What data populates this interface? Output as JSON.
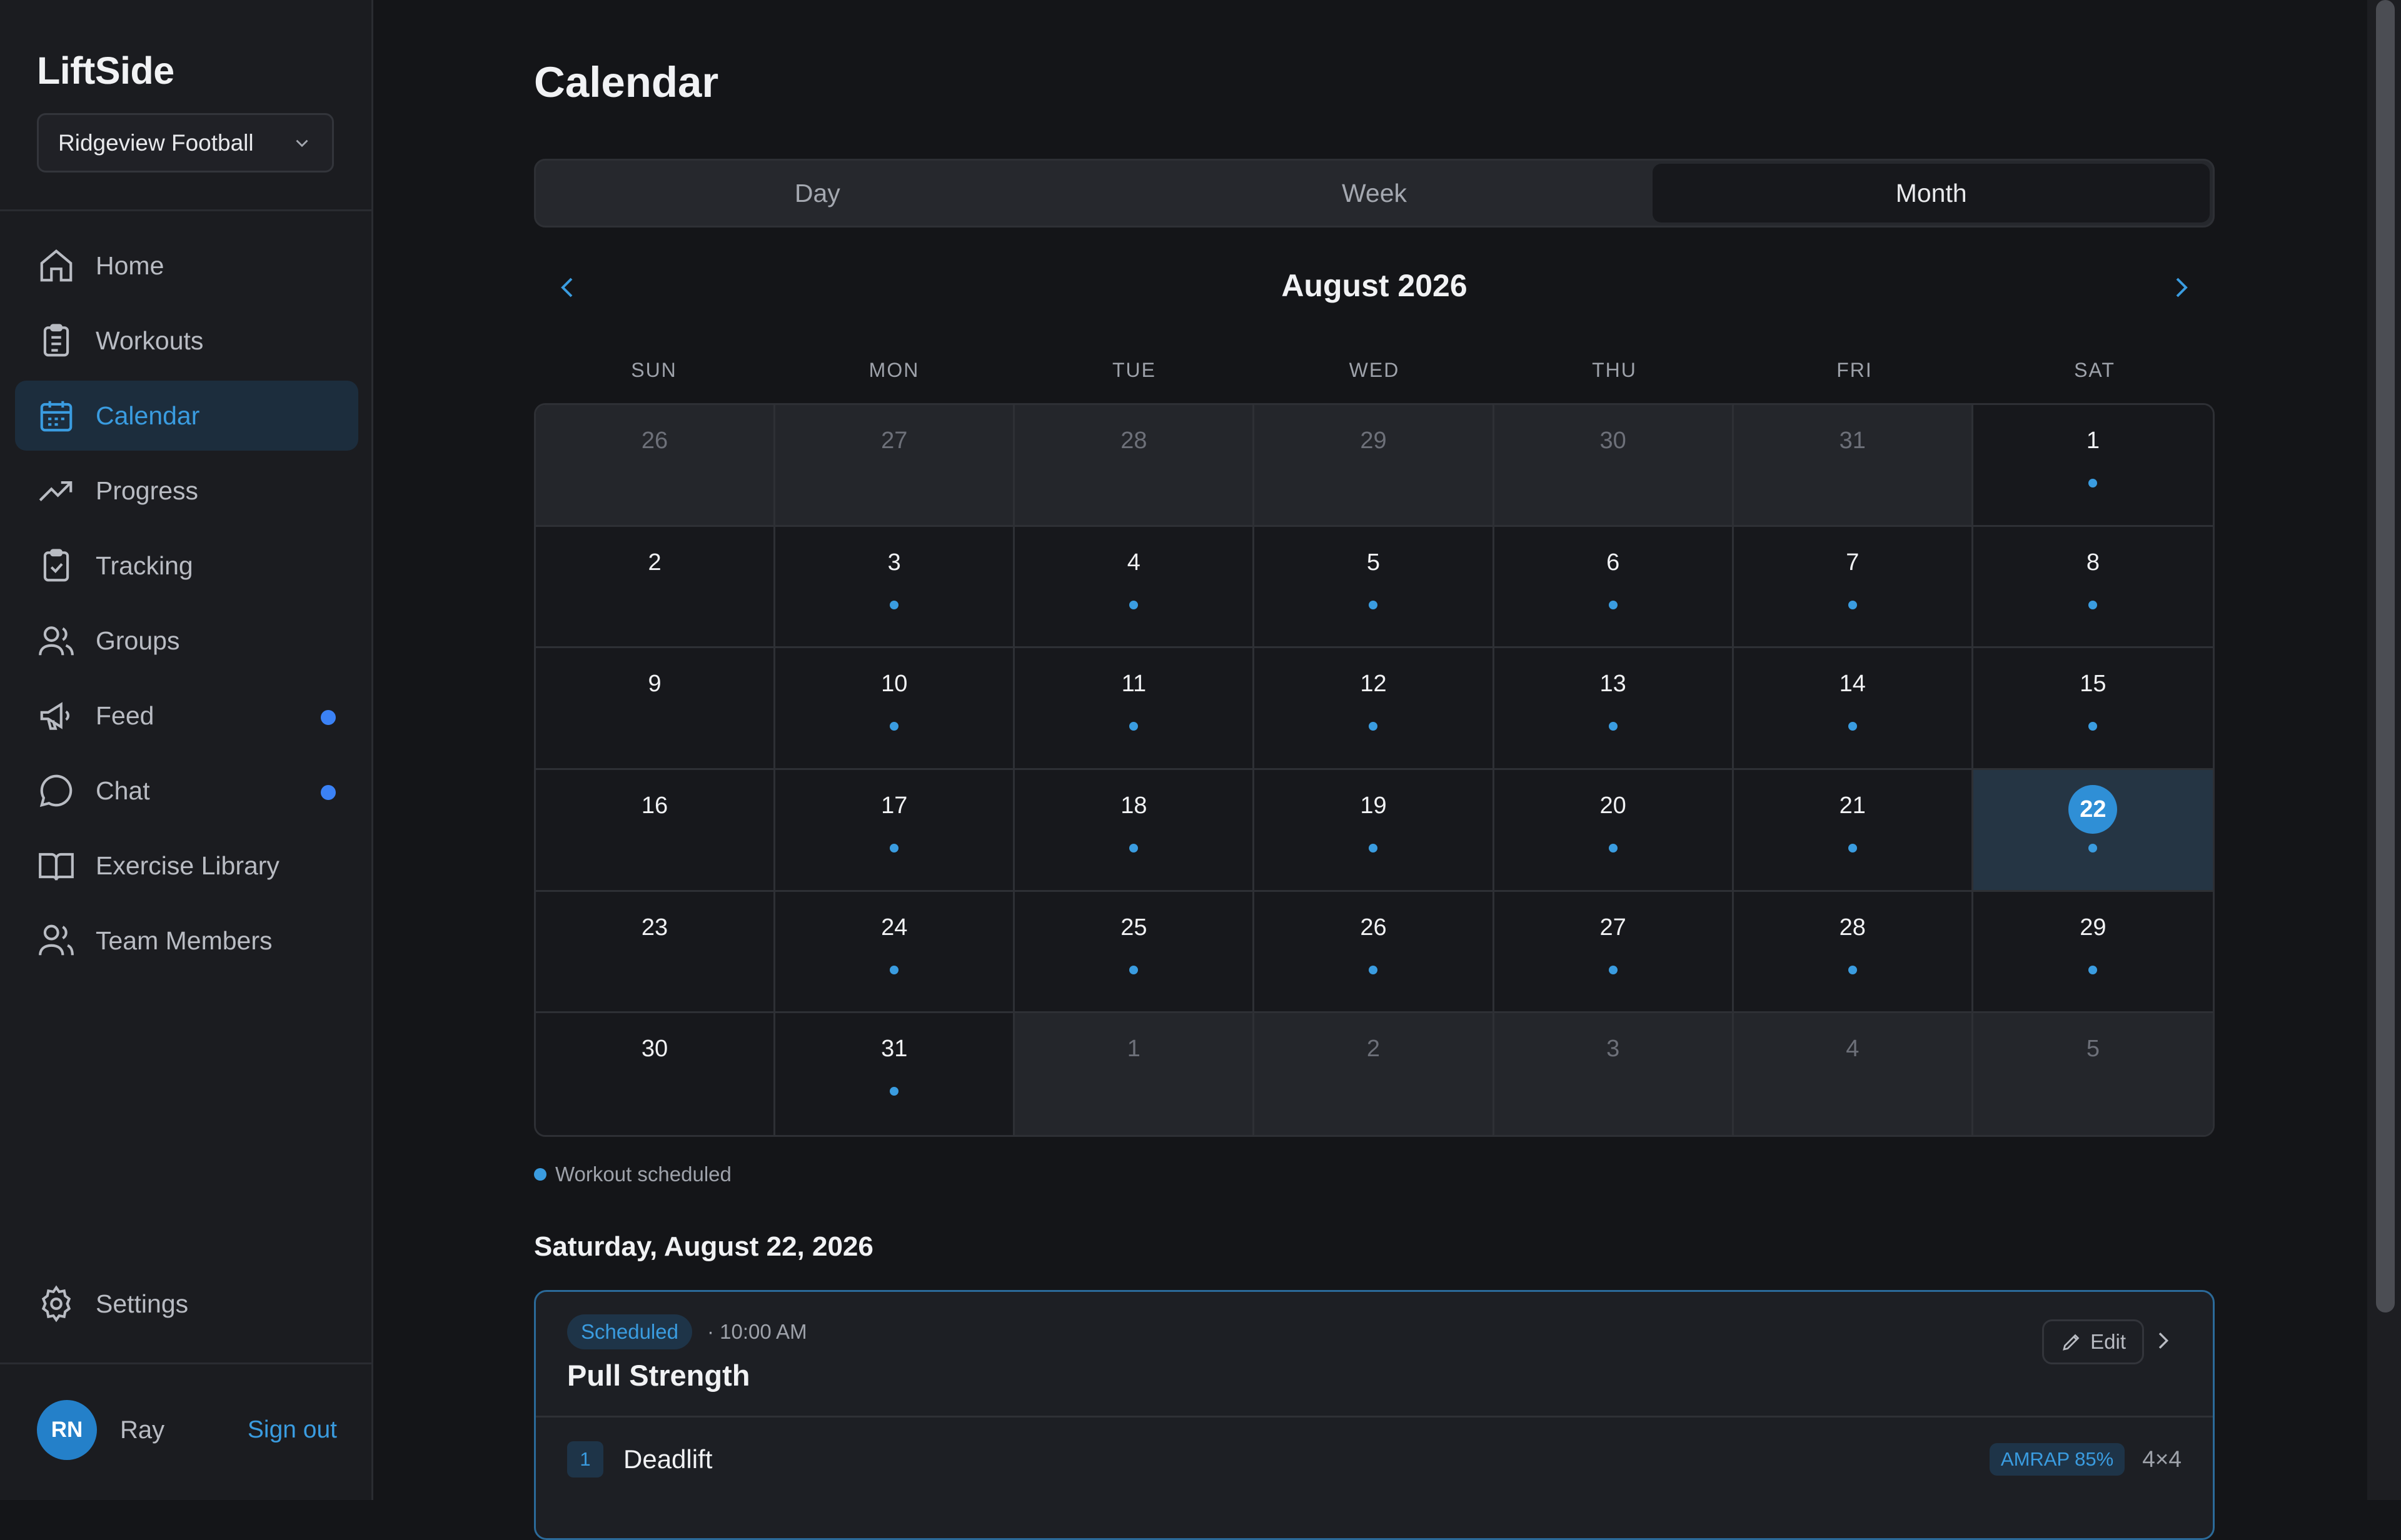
{
  "sidebar": {
    "brand": "LiftSide",
    "team": "Ridgeview Football",
    "items": [
      {
        "label": "Home",
        "icon": "home-icon",
        "active": false,
        "dot": false
      },
      {
        "label": "Workouts",
        "icon": "clipboard-list-icon",
        "active": false,
        "dot": false
      },
      {
        "label": "Calendar",
        "icon": "calendar-icon",
        "active": true,
        "dot": false
      },
      {
        "label": "Progress",
        "icon": "trending-up-icon",
        "active": false,
        "dot": false
      },
      {
        "label": "Tracking",
        "icon": "clipboard-check-icon",
        "active": false,
        "dot": false
      },
      {
        "label": "Groups",
        "icon": "users-icon",
        "active": false,
        "dot": false
      },
      {
        "label": "Feed",
        "icon": "megaphone-icon",
        "active": false,
        "dot": true
      },
      {
        "label": "Chat",
        "icon": "chat-bubble-icon",
        "active": false,
        "dot": true
      },
      {
        "label": "Exercise Library",
        "icon": "book-open-icon",
        "active": false,
        "dot": false
      },
      {
        "label": "Team Members",
        "icon": "team-icon",
        "active": false,
        "dot": false
      }
    ],
    "settings": "Settings",
    "user": {
      "initials": "RN",
      "name": "Ray",
      "sign_out": "Sign out"
    }
  },
  "main": {
    "title": "Calendar",
    "views": [
      {
        "label": "Day",
        "active": false
      },
      {
        "label": "Week",
        "active": false
      },
      {
        "label": "Month",
        "active": true
      }
    ],
    "month_title": "August 2026",
    "weekdays": [
      "SUN",
      "MON",
      "TUE",
      "WED",
      "THU",
      "FRI",
      "SAT"
    ],
    "days": [
      {
        "n": "26",
        "muted": true,
        "dot": false
      },
      {
        "n": "27",
        "muted": true,
        "dot": false
      },
      {
        "n": "28",
        "muted": true,
        "dot": false
      },
      {
        "n": "29",
        "muted": true,
        "dot": false
      },
      {
        "n": "30",
        "muted": true,
        "dot": false
      },
      {
        "n": "31",
        "muted": true,
        "dot": false
      },
      {
        "n": "1",
        "muted": false,
        "dot": true
      },
      {
        "n": "2",
        "muted": false,
        "dot": false
      },
      {
        "n": "3",
        "muted": false,
        "dot": true
      },
      {
        "n": "4",
        "muted": false,
        "dot": true
      },
      {
        "n": "5",
        "muted": false,
        "dot": true
      },
      {
        "n": "6",
        "muted": false,
        "dot": true
      },
      {
        "n": "7",
        "muted": false,
        "dot": true
      },
      {
        "n": "8",
        "muted": false,
        "dot": true
      },
      {
        "n": "9",
        "muted": false,
        "dot": false
      },
      {
        "n": "10",
        "muted": false,
        "dot": true
      },
      {
        "n": "11",
        "muted": false,
        "dot": true
      },
      {
        "n": "12",
        "muted": false,
        "dot": true
      },
      {
        "n": "13",
        "muted": false,
        "dot": true
      },
      {
        "n": "14",
        "muted": false,
        "dot": true
      },
      {
        "n": "15",
        "muted": false,
        "dot": true
      },
      {
        "n": "16",
        "muted": false,
        "dot": false
      },
      {
        "n": "17",
        "muted": false,
        "dot": true
      },
      {
        "n": "18",
        "muted": false,
        "dot": true
      },
      {
        "n": "19",
        "muted": false,
        "dot": true
      },
      {
        "n": "20",
        "muted": false,
        "dot": true
      },
      {
        "n": "21",
        "muted": false,
        "dot": true
      },
      {
        "n": "22",
        "muted": false,
        "dot": true,
        "selected": true
      },
      {
        "n": "23",
        "muted": false,
        "dot": false
      },
      {
        "n": "24",
        "muted": false,
        "dot": true
      },
      {
        "n": "25",
        "muted": false,
        "dot": true
      },
      {
        "n": "26",
        "muted": false,
        "dot": true
      },
      {
        "n": "27",
        "muted": false,
        "dot": true
      },
      {
        "n": "28",
        "muted": false,
        "dot": true
      },
      {
        "n": "29",
        "muted": false,
        "dot": true
      },
      {
        "n": "30",
        "muted": false,
        "dot": false
      },
      {
        "n": "31",
        "muted": false,
        "dot": true
      },
      {
        "n": "1",
        "muted": true,
        "dot": false
      },
      {
        "n": "2",
        "muted": true,
        "dot": false
      },
      {
        "n": "3",
        "muted": true,
        "dot": false
      },
      {
        "n": "4",
        "muted": true,
        "dot": false
      },
      {
        "n": "5",
        "muted": true,
        "dot": false
      }
    ],
    "legend": "Workout scheduled",
    "selected_date": "Saturday, August 22, 2026",
    "workout": {
      "status": "Scheduled",
      "time": "· 10:00 AM",
      "title": "Pull Strength",
      "edit_label": "Edit",
      "exercises": [
        {
          "index": "1",
          "name": "Deadlift",
          "tag": "AMRAP 85%",
          "scheme": "4×4"
        }
      ]
    }
  },
  "colors": {
    "accent": "#3a9ce0",
    "background": "#141518",
    "sidebar": "#1b1c20",
    "notification": "#3b82f6"
  }
}
